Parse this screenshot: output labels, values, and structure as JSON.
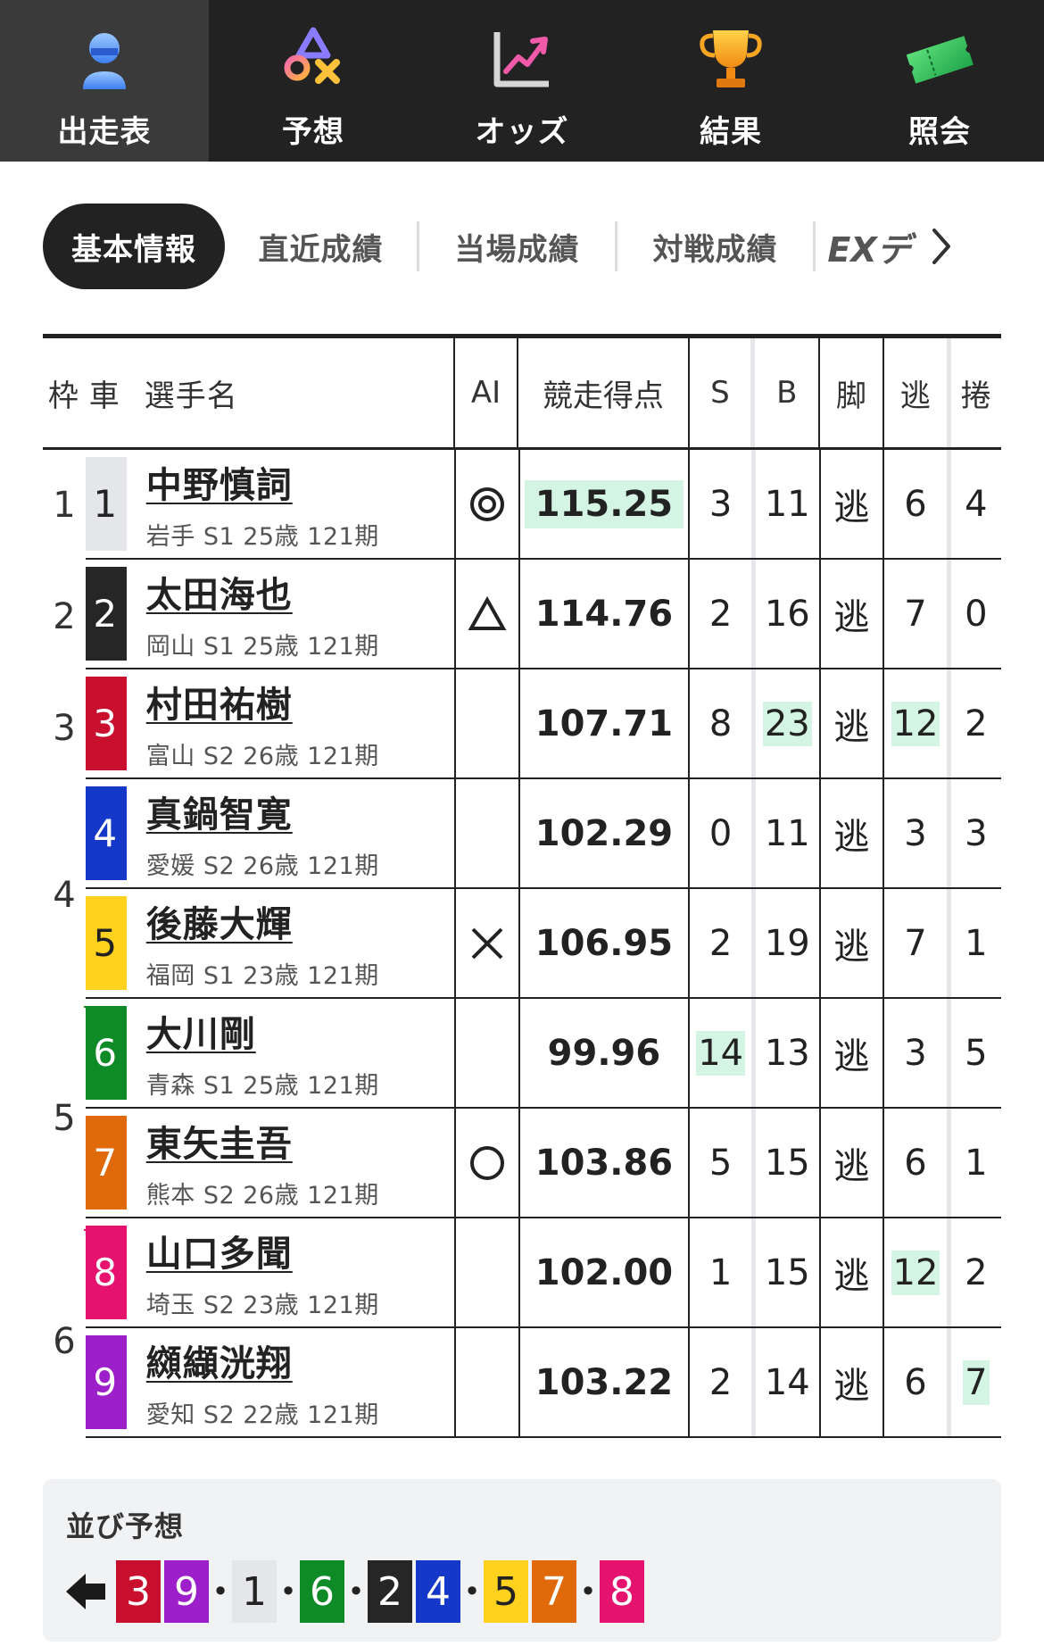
{
  "topnav": [
    {
      "label": "出走表",
      "icon": "person-icon",
      "active": true
    },
    {
      "label": "予想",
      "icon": "shapes-icon",
      "active": false
    },
    {
      "label": "オッズ",
      "icon": "trend-chart-icon",
      "active": false
    },
    {
      "label": "結果",
      "icon": "trophy-icon",
      "active": false
    },
    {
      "label": "照会",
      "icon": "ticket-icon",
      "active": false
    }
  ],
  "subtabs": {
    "active": "基本情報",
    "items": [
      "直近成績",
      "当場成績",
      "対戦成績"
    ],
    "ex": "EXデ"
  },
  "headers": {
    "frame": "枠",
    "car": "車",
    "name": "選手名",
    "ai": "AI",
    "score": "競走得点",
    "s": "S",
    "b": "B",
    "kyaku": "脚",
    "nige": "逃",
    "makuri": "捲"
  },
  "colors": {
    "highlight": "#d4f5e4",
    "car1": "#e4e6ea",
    "car2": "#262626",
    "car3": "#c8102e",
    "car4": "#1638c8",
    "car5": "#ffd21f",
    "car6": "#0e8a26",
    "car7": "#e06a0a",
    "car8": "#e5126e",
    "car9": "#9c1fc9"
  },
  "frames": [
    {
      "label": "1",
      "rows": 1
    },
    {
      "label": "2",
      "rows": 1
    },
    {
      "label": "3",
      "rows": 1
    },
    {
      "label": "4",
      "rows": 2
    },
    {
      "label": "5",
      "rows": 2
    },
    {
      "label": "6",
      "rows": 2
    }
  ],
  "racers": [
    {
      "car": "1",
      "name": "中野慎詞",
      "info": "岩手 S1 25歳 121期",
      "ai": "◎",
      "score": "115.25",
      "s": "3",
      "b": "11",
      "kyaku": "逃",
      "nige": "6",
      "makuri": "4"
    },
    {
      "car": "2",
      "name": "太田海也",
      "info": "岡山 S1 25歳 121期",
      "ai": "△",
      "score": "114.76",
      "s": "2",
      "b": "16",
      "kyaku": "逃",
      "nige": "7",
      "makuri": "0"
    },
    {
      "car": "3",
      "name": "村田祐樹",
      "info": "富山 S2 26歳 121期",
      "ai": "",
      "score": "107.71",
      "s": "8",
      "b": "23",
      "kyaku": "逃",
      "nige": "12",
      "makuri": "2"
    },
    {
      "car": "4",
      "name": "真鍋智寛",
      "info": "愛媛 S2 26歳 121期",
      "ai": "",
      "score": "102.29",
      "s": "0",
      "b": "11",
      "kyaku": "逃",
      "nige": "3",
      "makuri": "3"
    },
    {
      "car": "5",
      "name": "後藤大輝",
      "info": "福岡 S1 23歳 121期",
      "ai": "✕",
      "score": "106.95",
      "s": "2",
      "b": "19",
      "kyaku": "逃",
      "nige": "7",
      "makuri": "1"
    },
    {
      "car": "6",
      "name": "大川剛",
      "info": "青森 S1 25歳 121期",
      "ai": "",
      "score": "99.96",
      "s": "14",
      "b": "13",
      "kyaku": "逃",
      "nige": "3",
      "makuri": "5"
    },
    {
      "car": "7",
      "name": "東矢圭吾",
      "info": "熊本 S2 26歳 121期",
      "ai": "○",
      "score": "103.86",
      "s": "5",
      "b": "15",
      "kyaku": "逃",
      "nige": "6",
      "makuri": "1"
    },
    {
      "car": "8",
      "name": "山口多聞",
      "info": "埼玉 S2 23歳 121期",
      "ai": "",
      "score": "102.00",
      "s": "1",
      "b": "15",
      "kyaku": "逃",
      "nige": "12",
      "makuri": "2"
    },
    {
      "car": "9",
      "name": "纐纈洸翔",
      "info": "愛知 S2 22歳 121期",
      "ai": "",
      "score": "103.22",
      "s": "2",
      "b": "14",
      "kyaku": "逃",
      "nige": "6",
      "makuri": "7"
    }
  ],
  "highlights": {
    "score": [
      "1"
    ],
    "s": [
      "6"
    ],
    "b": [
      "3"
    ],
    "nige": [
      "3",
      "8"
    ],
    "makuri": [
      "9"
    ]
  },
  "prediction": {
    "title": "並び予想",
    "direction_icon": "left-arrow-icon",
    "groups": [
      [
        "3",
        "9"
      ],
      [
        "1"
      ],
      [
        "6"
      ],
      [
        "2",
        "4"
      ],
      [
        "5",
        "7"
      ],
      [
        "8"
      ]
    ]
  }
}
